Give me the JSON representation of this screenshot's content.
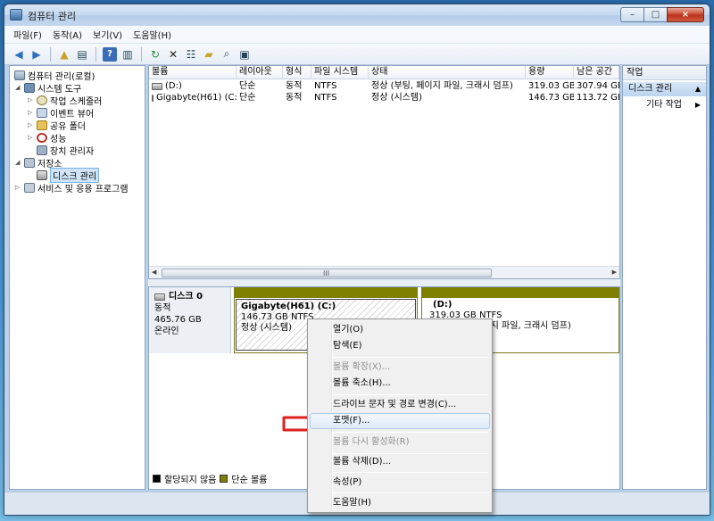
{
  "window": {
    "title": "컴퓨터 관리"
  },
  "window_controls": [
    "–",
    "□",
    "×"
  ],
  "menu": [
    "파일(F)",
    "동작(A)",
    "보기(V)",
    "도움말(H)"
  ],
  "toolbar_icons": [
    "back-icon",
    "forward-icon",
    "up-icon",
    "show-hide-tree-icon",
    "help-icon",
    "show-hide-action-icon",
    "refresh-icon",
    "delete-icon",
    "properties-icon",
    "open-icon",
    "search-icon",
    "export-icon"
  ],
  "tree": [
    {
      "label": "컴퓨터 관리(로컬)",
      "level": 0,
      "exp": ""
    },
    {
      "label": "시스템 도구",
      "level": 1,
      "exp": "◢"
    },
    {
      "label": "작업 스케줄러",
      "level": 2,
      "exp": "▷"
    },
    {
      "label": "이벤트 뷰어",
      "level": 2,
      "exp": "▷"
    },
    {
      "label": "공유 폴더",
      "level": 2,
      "exp": "▷"
    },
    {
      "label": "성능",
      "level": 2,
      "exp": "▷"
    },
    {
      "label": "장치 관리자",
      "level": 2,
      "exp": ""
    },
    {
      "label": "저장소",
      "level": 1,
      "exp": "◢"
    },
    {
      "label": "디스크 관리",
      "level": 2,
      "exp": "",
      "selected": true
    },
    {
      "label": "서비스 및 응용 프로그램",
      "level": 1,
      "exp": "▷"
    }
  ],
  "volumes": {
    "columns": [
      "볼륨",
      "레이아웃",
      "형식",
      "파일 시스템",
      "상태",
      "용량",
      "남은 공간"
    ],
    "rows": [
      [
        "(D:)",
        "단순",
        "동적",
        "NTFS",
        "정상 (부팅, 페이지 파일, 크래시 덤프)",
        "319.03 GB",
        "307.94 GB"
      ],
      [
        "Gigabyte(H61) (C:)",
        "단순",
        "동적",
        "NTFS",
        "정상 (시스템)",
        "146.73 GB",
        "113.72 GB"
      ]
    ],
    "scroll_grip": "III"
  },
  "disk": {
    "title": "디스크 0",
    "type": "동적",
    "size": "465.76 GB",
    "status": "온라인",
    "partitions": [
      {
        "name": "Gigabyte(H61)  (C:)",
        "size": "146.73 GB NTFS",
        "status": "정상 (시스템)"
      },
      {
        "name": "(D:)",
        "size": "319.03 GB NTFS",
        "status": "정상 (부팅, 페이지 파일, 크래시 덤프)"
      }
    ]
  },
  "legend": [
    "할당되지 않음",
    "단순 볼륨"
  ],
  "actions": {
    "header": "작업",
    "section": "디스크 관리",
    "item": "기타 작업"
  },
  "context_menu": [
    {
      "label": "열기(O)",
      "disabled": false
    },
    {
      "label": "탐색(E)",
      "disabled": false
    },
    {
      "sep": true
    },
    {
      "label": "볼륨 확장(X)...",
      "disabled": true
    },
    {
      "label": "볼륨 축소(H)...",
      "disabled": false
    },
    {
      "sep": true
    },
    {
      "label": "드라이브 문자 및 경로 변경(C)...",
      "disabled": false
    },
    {
      "label": "포맷(F)...",
      "disabled": false,
      "hover": true
    },
    {
      "sep": true
    },
    {
      "label": "볼륨 다시 활성화(R)",
      "disabled": true
    },
    {
      "sep": true
    },
    {
      "label": "볼륨 삭제(D)...",
      "disabled": false
    },
    {
      "sep": true
    },
    {
      "label": "속성(P)",
      "disabled": false
    },
    {
      "sep": true
    },
    {
      "label": "도움말(H)",
      "disabled": false
    }
  ],
  "colors": {
    "simple_volume": "#7f7f00",
    "unallocated": "#000000",
    "arrow": "#e02020"
  }
}
